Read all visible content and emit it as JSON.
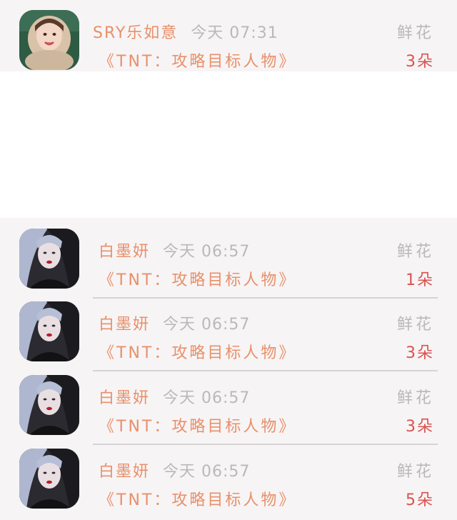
{
  "entries": [
    {
      "user": "SRY乐如意",
      "time": "今天 07:31",
      "book": "《TNT：攻略目标人物》",
      "gift_type": "鲜花",
      "gift_count": "3朵",
      "avatar": "girl-with-furry-hood-avatar"
    },
    {
      "user": "白墨妍",
      "time": "今天 06:57",
      "book": "《TNT：攻略目标人物》",
      "gift_type": "鲜花",
      "gift_count": "1朵",
      "avatar": "silver-hair-girl-avatar"
    },
    {
      "user": "白墨妍",
      "time": "今天 06:57",
      "book": "《TNT：攻略目标人物》",
      "gift_type": "鲜花",
      "gift_count": "3朵",
      "avatar": "silver-hair-girl-avatar"
    },
    {
      "user": "白墨妍",
      "time": "今天 06:57",
      "book": "《TNT：攻略目标人物》",
      "gift_type": "鲜花",
      "gift_count": "3朵",
      "avatar": "silver-hair-girl-avatar"
    },
    {
      "user": "白墨妍",
      "time": "今天 06:57",
      "book": "《TNT：攻略目标人物》",
      "gift_type": "鲜花",
      "gift_count": "5朵",
      "avatar": "silver-hair-girl-avatar"
    }
  ],
  "colors": {
    "name": "#e8906a",
    "meta": "#b9b9b9",
    "count": "#d9534f",
    "background": "#f7f4f5"
  }
}
